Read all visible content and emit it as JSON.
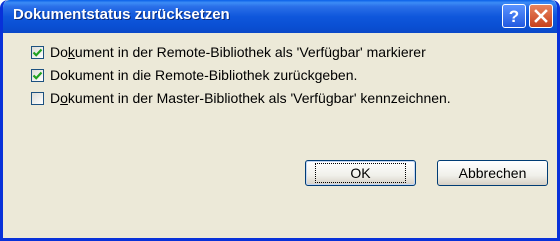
{
  "window": {
    "title": "Dokumentstatus zurücksetzen",
    "help_button": "?",
    "close_button": "close"
  },
  "options": [
    {
      "checked": true,
      "pre": "Do",
      "accel": "k",
      "post": "ument in der Remote-Bibliothek als 'Verfügbar' markierer"
    },
    {
      "checked": true,
      "pre": "Dokument in die Remote-Bibliothek zurückgeben.",
      "accel": "",
      "post": ""
    },
    {
      "checked": false,
      "pre": "D",
      "accel": "o",
      "post": "kument in der Master-Bibliothek als 'Verfügbar' kennzeichnen."
    }
  ],
  "buttons": {
    "ok": "OK",
    "cancel": "Abbrechen"
  },
  "colors": {
    "titlebar": "#0a4fd3",
    "dialog_bg": "#ece9d8",
    "check": "#21a121",
    "close_button": "#c8401c"
  }
}
